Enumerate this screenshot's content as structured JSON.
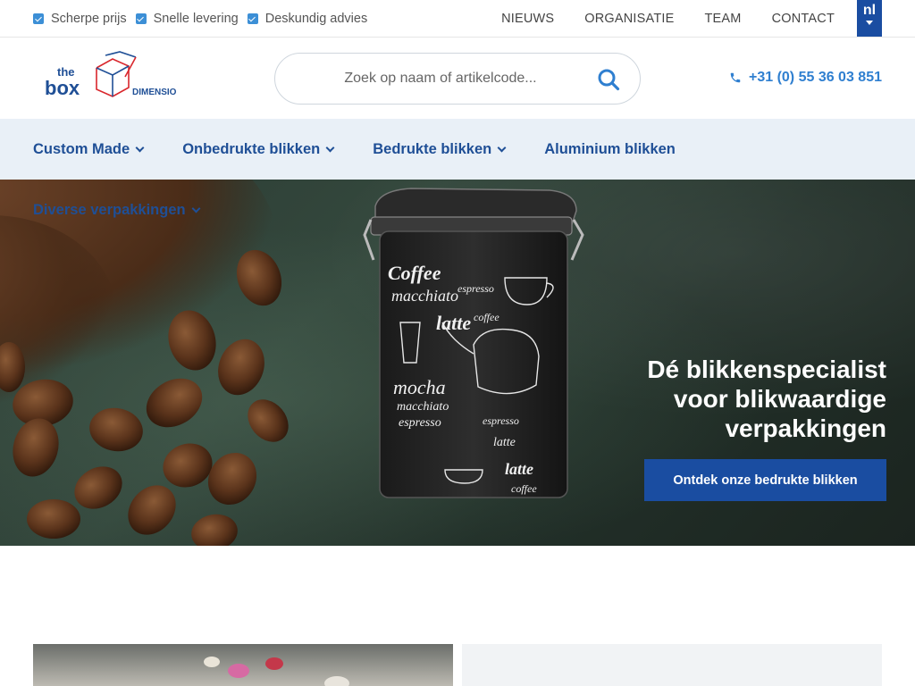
{
  "topbar": {
    "usps": [
      "Scherpe prijs",
      "Snelle levering",
      "Deskundig advies"
    ],
    "nav": [
      "NIEUWS",
      "ORGANISATIE",
      "TEAM",
      "CONTACT"
    ],
    "language": "nl"
  },
  "header": {
    "logo": {
      "the": "the",
      "box": "box",
      "brand": "DIMENSIO"
    },
    "search_placeholder": "Zoek op naam of artikelcode...",
    "phone": "+31 (0) 55 36 03 851"
  },
  "mainnav": {
    "items": [
      {
        "label": "Custom Made",
        "dropdown": true
      },
      {
        "label": "Onbedrukte blikken",
        "dropdown": true
      },
      {
        "label": "Bedrukte blikken",
        "dropdown": true
      },
      {
        "label": "Aluminium blikken",
        "dropdown": false
      }
    ],
    "overflow_item": {
      "label": "Diverse verpakkingen",
      "dropdown": true
    }
  },
  "hero": {
    "title_lines": [
      "Dé blikkenspecialist",
      "voor blikwaardige",
      "verpakkingen"
    ],
    "cta": "Ontdek onze bedrukte blikken",
    "tin_words": [
      "Coffee",
      "macchiato",
      "espresso",
      "coffee",
      "latte",
      "mocha",
      "macchiato",
      "espresso",
      "espresso",
      "latte",
      "latte",
      "coffee"
    ]
  },
  "colors": {
    "primary": "#1a4da1",
    "nav_text": "#1f4f96",
    "accent_link": "#2f7fd0",
    "nav_bg": "#e9f0f7",
    "check": "#3c8fd6"
  },
  "icons": {
    "usp": "checkbox-checked-icon",
    "search": "search-icon",
    "phone": "phone-icon",
    "dropdown": "chevron-down-icon"
  }
}
